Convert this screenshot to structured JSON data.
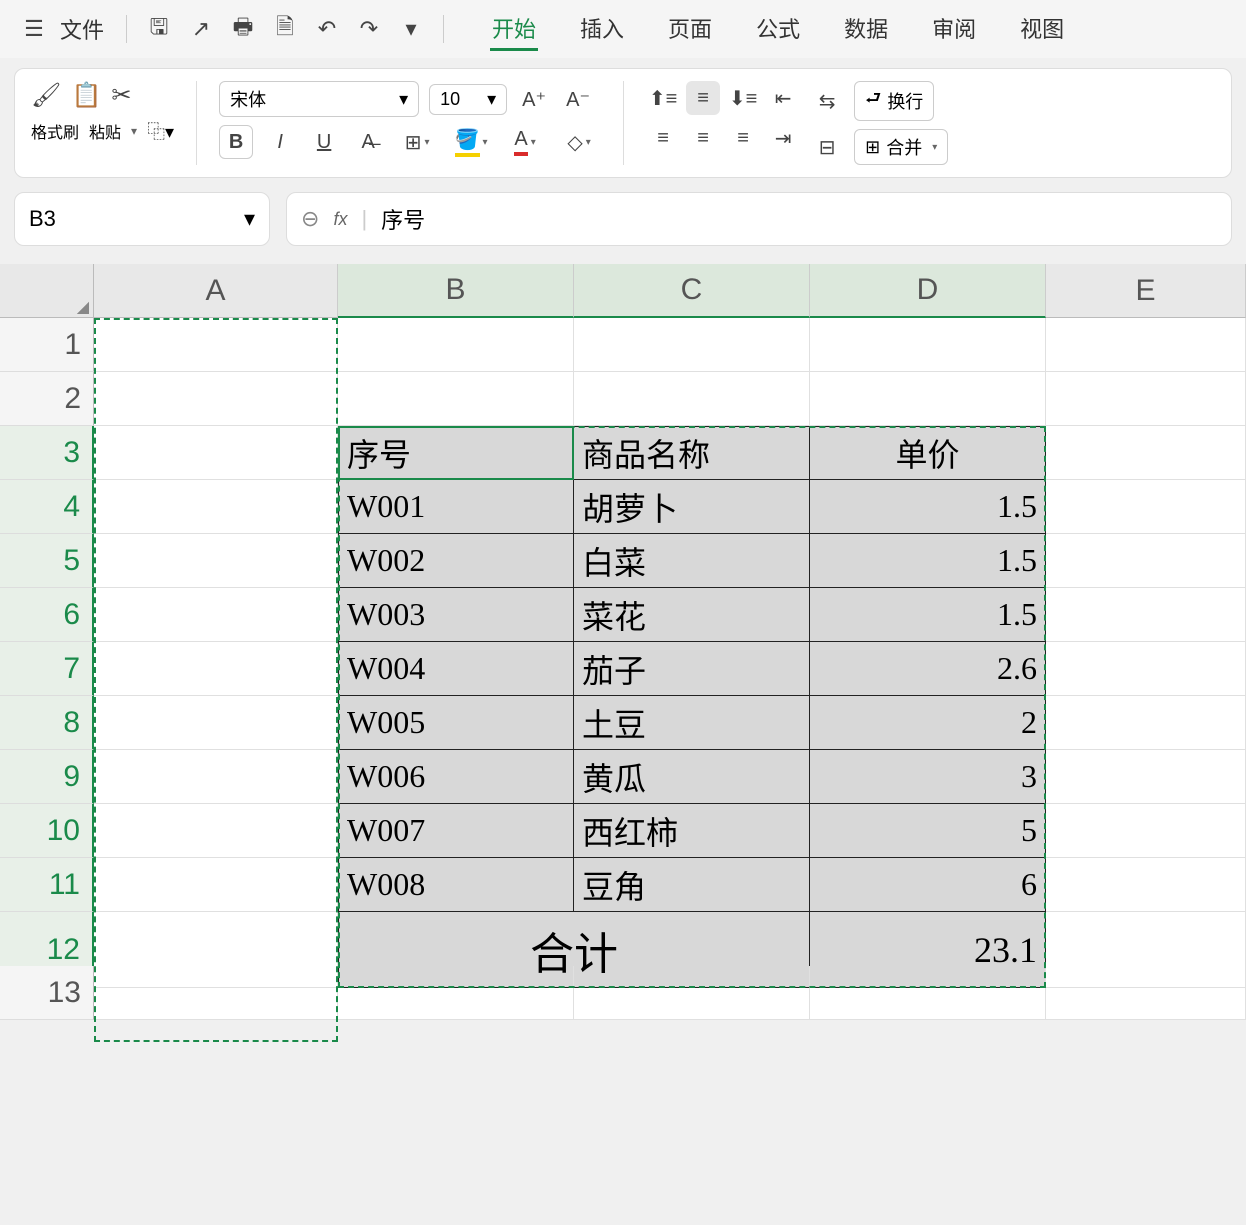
{
  "menubar": {
    "file_label": "文件",
    "tabs": [
      "开始",
      "插入",
      "页面",
      "公式",
      "数据",
      "审阅",
      "视图"
    ],
    "active_tab": "开始"
  },
  "ribbon": {
    "format_painter": "格式刷",
    "paste": "粘贴",
    "font_name": "宋体",
    "font_size": "10",
    "bold": "B",
    "italic": "I",
    "underline": "U",
    "wrap_text": "换行",
    "merge": "合并"
  },
  "name_box": "B3",
  "formula_value": "序号",
  "columns": [
    "A",
    "B",
    "C",
    "D",
    "E"
  ],
  "rows": [
    "1",
    "2",
    "3",
    "4",
    "5",
    "6",
    "7",
    "8",
    "9",
    "10",
    "11",
    "12",
    "13"
  ],
  "table": {
    "header": {
      "b": "序号",
      "c": "商品名称",
      "d": "单价"
    },
    "rows": [
      {
        "b": "W001",
        "c": "胡萝卜",
        "d": "1.5"
      },
      {
        "b": "W002",
        "c": "白菜",
        "d": "1.5"
      },
      {
        "b": "W003",
        "c": "菜花",
        "d": "1.5"
      },
      {
        "b": "W004",
        "c": "茄子",
        "d": "2.6"
      },
      {
        "b": "W005",
        "c": "土豆",
        "d": "2"
      },
      {
        "b": "W006",
        "c": "黄瓜",
        "d": "3"
      },
      {
        "b": "W007",
        "c": "西红柿",
        "d": "5"
      },
      {
        "b": "W008",
        "c": "豆角",
        "d": "6"
      }
    ],
    "total_label": "合计",
    "total_value": "23.1"
  }
}
